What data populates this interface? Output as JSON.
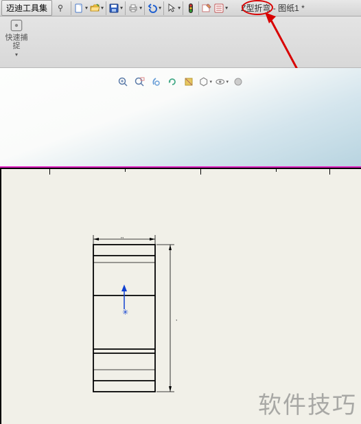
{
  "topbar": {
    "menu_label": "迈迪工具集",
    "doc_title": "Z型折弯 - 图纸1 *"
  },
  "secondbar": {
    "snap_line1": "快速捕",
    "snap_line2": "捉"
  },
  "icons": {
    "new": "new-doc",
    "open": "folder-open",
    "save": "save",
    "print": "print",
    "undo": "undo",
    "select": "arrow-cursor",
    "rebuild": "traffic-light",
    "options": "properties-sheet",
    "options2": "list-sheet"
  },
  "watermark": "软件技巧"
}
